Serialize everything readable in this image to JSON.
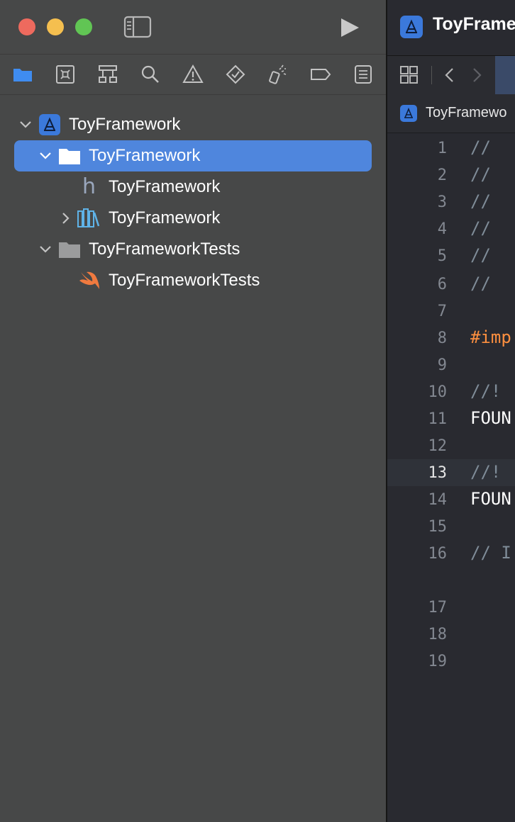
{
  "navigator": {
    "toolbar_icons": [
      "folder-icon",
      "source-control-icon",
      "hierarchy-icon",
      "search-icon",
      "warning-icon",
      "test-diamond-icon",
      "debug-spray-icon",
      "breakpoint-icon",
      "report-icon"
    ],
    "tree": [
      {
        "label": "ToyFramework",
        "icon": "project-icon",
        "expanded": true,
        "selected": false
      },
      {
        "label": "ToyFramework",
        "icon": "folder-icon",
        "expanded": true,
        "selected": true
      },
      {
        "label": "ToyFramework",
        "icon": "header-file-icon",
        "selected": false
      },
      {
        "label": "ToyFramework",
        "icon": "framework-books-icon",
        "expanded": false,
        "selected": false
      },
      {
        "label": "ToyFrameworkTests",
        "icon": "folder-icon",
        "expanded": true,
        "selected": false
      },
      {
        "label": "ToyFrameworkTests",
        "icon": "swift-icon",
        "selected": false
      }
    ]
  },
  "editor": {
    "tab_title": "ToyFrame",
    "breadcrumb": "ToyFramewo",
    "current_line": "13",
    "lines": [
      {
        "n": "1",
        "text": "//",
        "kind": "comment"
      },
      {
        "n": "2",
        "text": "//",
        "kind": "comment"
      },
      {
        "n": "3",
        "text": "//",
        "kind": "comment"
      },
      {
        "n": "4",
        "text": "//",
        "kind": "comment"
      },
      {
        "n": "5",
        "text": "//",
        "kind": "comment"
      },
      {
        "n": "6",
        "text": "//",
        "kind": "comment"
      },
      {
        "n": "7",
        "text": "",
        "kind": "plain"
      },
      {
        "n": "8",
        "text": "#imp",
        "kind": "preprocessor"
      },
      {
        "n": "9",
        "text": "",
        "kind": "plain"
      },
      {
        "n": "10",
        "text": "//!",
        "kind": "comment"
      },
      {
        "n": "11",
        "text": "FOUN",
        "kind": "plain"
      },
      {
        "n": "12",
        "text": "",
        "kind": "plain"
      },
      {
        "n": "13",
        "text": "//!",
        "kind": "comment"
      },
      {
        "n": "14",
        "text": "FOUN",
        "kind": "plain"
      },
      {
        "n": "15",
        "text": "",
        "kind": "plain"
      },
      {
        "n": "16",
        "text": "// I",
        "kind": "comment"
      },
      {
        "n": "17",
        "text": "",
        "kind": "plain"
      },
      {
        "n": "18",
        "text": "",
        "kind": "plain"
      },
      {
        "n": "19",
        "text": "",
        "kind": "plain"
      }
    ]
  },
  "colors": {
    "accent": "#4f86dd",
    "sidebar_bg": "#474848",
    "editor_bg": "#292a30",
    "preprocessor": "#fd8f3f",
    "comment": "#7f8c98"
  }
}
